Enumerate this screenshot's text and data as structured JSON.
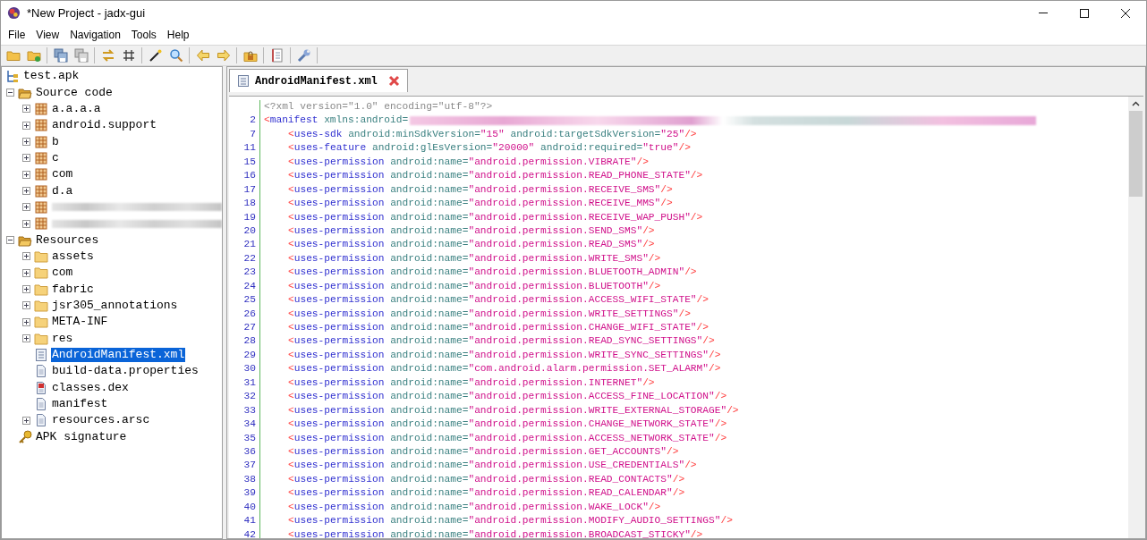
{
  "window": {
    "title": "*New Project - jadx-gui"
  },
  "menu": [
    "File",
    "View",
    "Navigation",
    "Tools",
    "Help"
  ],
  "tree": [
    {
      "label": "test.apk",
      "kind": "apk",
      "selected": false,
      "children": [
        {
          "label": "Source code",
          "kind": "source",
          "expanded": true,
          "selected": false,
          "children": [
            {
              "label": "a.a.a.a",
              "kind": "package",
              "expanded": false,
              "selected": false
            },
            {
              "label": "android.support",
              "kind": "package",
              "expanded": false,
              "selected": false
            },
            {
              "label": "b",
              "kind": "package",
              "expanded": false,
              "selected": false
            },
            {
              "label": "c",
              "kind": "package",
              "expanded": false,
              "selected": false
            },
            {
              "label": "com",
              "kind": "package",
              "expanded": false,
              "selected": false
            },
            {
              "label": "d.a",
              "kind": "package",
              "expanded": false,
              "selected": false
            },
            {
              "kind": "package",
              "redacted": true,
              "expanded": false,
              "selected": false
            },
            {
              "kind": "package",
              "redacted": true,
              "expanded": false,
              "selected": false
            }
          ]
        },
        {
          "label": "Resources",
          "kind": "resources",
          "expanded": true,
          "selected": false,
          "children": [
            {
              "label": "assets",
              "kind": "folder",
              "expanded": false,
              "selected": false
            },
            {
              "label": "com",
              "kind": "folder",
              "expanded": false,
              "selected": false
            },
            {
              "label": "fabric",
              "kind": "folder",
              "expanded": false,
              "selected": false
            },
            {
              "label": "jsr305_annotations",
              "kind": "folder",
              "expanded": false,
              "selected": false
            },
            {
              "label": "META-INF",
              "kind": "folder",
              "expanded": false,
              "selected": false
            },
            {
              "label": "res",
              "kind": "folder",
              "expanded": false,
              "selected": false
            },
            {
              "label": "AndroidManifest.xml",
              "kind": "xml",
              "selected": true
            },
            {
              "label": "build-data.properties",
              "kind": "file",
              "selected": false
            },
            {
              "label": "classes.dex",
              "kind": "dex",
              "selected": false
            },
            {
              "label": "manifest",
              "kind": "file",
              "selected": false
            },
            {
              "label": "resources.arsc",
              "kind": "file",
              "expanded": false,
              "selected": false
            }
          ]
        },
        {
          "label": "APK signature",
          "kind": "key",
          "selected": false
        }
      ]
    }
  ],
  "tabs": [
    {
      "label": "AndroidManifest.xml",
      "selected": true
    }
  ],
  "code": [
    {
      "segments": [
        {
          "kind": "decl",
          "text": "<?xml version=\"1.0\" encoding=\"utf-8\"?>"
        }
      ]
    },
    {
      "number": "2",
      "segments": [
        {
          "kind": "bracket",
          "text": "<"
        },
        {
          "kind": "tag",
          "text": "manifest"
        },
        {
          "kind": "attr",
          "text": " xmlns:android="
        },
        {
          "kind": "redacted"
        }
      ],
      "children": [
        {
          "number": "7",
          "segments": [
            {
              "kind": "bracket",
              "text": "<"
            },
            {
              "kind": "tag",
              "text": "uses-sdk"
            },
            {
              "kind": "attr",
              "text": " android:minSdkVersion="
            },
            {
              "kind": "value",
              "text": "\"15\""
            },
            {
              "kind": "attr",
              "text": " android:targetSdkVersion="
            },
            {
              "kind": "value",
              "text": "\"25\""
            },
            {
              "kind": "bracket",
              "text": "/>"
            }
          ]
        },
        {
          "number": "11",
          "segments": [
            {
              "kind": "bracket",
              "text": "<"
            },
            {
              "kind": "tag",
              "text": "uses-feature"
            },
            {
              "kind": "attr",
              "text": " android:glEsVersion="
            },
            {
              "kind": "value",
              "text": "\"20000\""
            },
            {
              "kind": "attr",
              "text": " android:required="
            },
            {
              "kind": "value",
              "text": "\"true\""
            },
            {
              "kind": "bracket",
              "text": "/>"
            }
          ]
        },
        {
          "number": "15",
          "segments": [
            {
              "kind": "bracket",
              "text": "<"
            },
            {
              "kind": "tag",
              "text": "uses-permission"
            },
            {
              "kind": "attr",
              "text": " android:name="
            },
            {
              "kind": "value",
              "text": "\"android.permission.VIBRATE\""
            },
            {
              "kind": "bracket",
              "text": "/>"
            }
          ]
        },
        {
          "number": "16",
          "segments": [
            {
              "kind": "bracket",
              "text": "<"
            },
            {
              "kind": "tag",
              "text": "uses-permission"
            },
            {
              "kind": "attr",
              "text": " android:name="
            },
            {
              "kind": "value",
              "text": "\"android.permission.READ_PHONE_STATE\""
            },
            {
              "kind": "bracket",
              "text": "/>"
            }
          ]
        },
        {
          "number": "17",
          "segments": [
            {
              "kind": "bracket",
              "text": "<"
            },
            {
              "kind": "tag",
              "text": "uses-permission"
            },
            {
              "kind": "attr",
              "text": " android:name="
            },
            {
              "kind": "value",
              "text": "\"android.permission.RECEIVE_SMS\""
            },
            {
              "kind": "bracket",
              "text": "/>"
            }
          ]
        },
        {
          "number": "18",
          "segments": [
            {
              "kind": "bracket",
              "text": "<"
            },
            {
              "kind": "tag",
              "text": "uses-permission"
            },
            {
              "kind": "attr",
              "text": " android:name="
            },
            {
              "kind": "value",
              "text": "\"android.permission.RECEIVE_MMS\""
            },
            {
              "kind": "bracket",
              "text": "/>"
            }
          ]
        },
        {
          "number": "19",
          "segments": [
            {
              "kind": "bracket",
              "text": "<"
            },
            {
              "kind": "tag",
              "text": "uses-permission"
            },
            {
              "kind": "attr",
              "text": " android:name="
            },
            {
              "kind": "value",
              "text": "\"android.permission.RECEIVE_WAP_PUSH\""
            },
            {
              "kind": "bracket",
              "text": "/>"
            }
          ]
        },
        {
          "number": "20",
          "segments": [
            {
              "kind": "bracket",
              "text": "<"
            },
            {
              "kind": "tag",
              "text": "uses-permission"
            },
            {
              "kind": "attr",
              "text": " android:name="
            },
            {
              "kind": "value",
              "text": "\"android.permission.SEND_SMS\""
            },
            {
              "kind": "bracket",
              "text": "/>"
            }
          ]
        },
        {
          "number": "21",
          "segments": [
            {
              "kind": "bracket",
              "text": "<"
            },
            {
              "kind": "tag",
              "text": "uses-permission"
            },
            {
              "kind": "attr",
              "text": " android:name="
            },
            {
              "kind": "value",
              "text": "\"android.permission.READ_SMS\""
            },
            {
              "kind": "bracket",
              "text": "/>"
            }
          ]
        },
        {
          "number": "22",
          "segments": [
            {
              "kind": "bracket",
              "text": "<"
            },
            {
              "kind": "tag",
              "text": "uses-permission"
            },
            {
              "kind": "attr",
              "text": " android:name="
            },
            {
              "kind": "value",
              "text": "\"android.permission.WRITE_SMS\""
            },
            {
              "kind": "bracket",
              "text": "/>"
            }
          ]
        },
        {
          "number": "23",
          "segments": [
            {
              "kind": "bracket",
              "text": "<"
            },
            {
              "kind": "tag",
              "text": "uses-permission"
            },
            {
              "kind": "attr",
              "text": " android:name="
            },
            {
              "kind": "value",
              "text": "\"android.permission.BLUETOOTH_ADMIN\""
            },
            {
              "kind": "bracket",
              "text": "/>"
            }
          ]
        },
        {
          "number": "24",
          "segments": [
            {
              "kind": "bracket",
              "text": "<"
            },
            {
              "kind": "tag",
              "text": "uses-permission"
            },
            {
              "kind": "attr",
              "text": " android:name="
            },
            {
              "kind": "value",
              "text": "\"android.permission.BLUETOOTH\""
            },
            {
              "kind": "bracket",
              "text": "/>"
            }
          ]
        },
        {
          "number": "25",
          "segments": [
            {
              "kind": "bracket",
              "text": "<"
            },
            {
              "kind": "tag",
              "text": "uses-permission"
            },
            {
              "kind": "attr",
              "text": " android:name="
            },
            {
              "kind": "value",
              "text": "\"android.permission.ACCESS_WIFI_STATE\""
            },
            {
              "kind": "bracket",
              "text": "/>"
            }
          ]
        },
        {
          "number": "26",
          "segments": [
            {
              "kind": "bracket",
              "text": "<"
            },
            {
              "kind": "tag",
              "text": "uses-permission"
            },
            {
              "kind": "attr",
              "text": " android:name="
            },
            {
              "kind": "value",
              "text": "\"android.permission.WRITE_SETTINGS\""
            },
            {
              "kind": "bracket",
              "text": "/>"
            }
          ]
        },
        {
          "number": "27",
          "segments": [
            {
              "kind": "bracket",
              "text": "<"
            },
            {
              "kind": "tag",
              "text": "uses-permission"
            },
            {
              "kind": "attr",
              "text": " android:name="
            },
            {
              "kind": "value",
              "text": "\"android.permission.CHANGE_WIFI_STATE\""
            },
            {
              "kind": "bracket",
              "text": "/>"
            }
          ]
        },
        {
          "number": "28",
          "segments": [
            {
              "kind": "bracket",
              "text": "<"
            },
            {
              "kind": "tag",
              "text": "uses-permission"
            },
            {
              "kind": "attr",
              "text": " android:name="
            },
            {
              "kind": "value",
              "text": "\"android.permission.READ_SYNC_SETTINGS\""
            },
            {
              "kind": "bracket",
              "text": "/>"
            }
          ]
        },
        {
          "number": "29",
          "segments": [
            {
              "kind": "bracket",
              "text": "<"
            },
            {
              "kind": "tag",
              "text": "uses-permission"
            },
            {
              "kind": "attr",
              "text": " android:name="
            },
            {
              "kind": "value",
              "text": "\"android.permission.WRITE_SYNC_SETTINGS\""
            },
            {
              "kind": "bracket",
              "text": "/>"
            }
          ]
        },
        {
          "number": "30",
          "segments": [
            {
              "kind": "bracket",
              "text": "<"
            },
            {
              "kind": "tag",
              "text": "uses-permission"
            },
            {
              "kind": "attr",
              "text": " android:name="
            },
            {
              "kind": "value",
              "text": "\"com.android.alarm.permission.SET_ALARM\""
            },
            {
              "kind": "bracket",
              "text": "/>"
            }
          ]
        },
        {
          "number": "31",
          "segments": [
            {
              "kind": "bracket",
              "text": "<"
            },
            {
              "kind": "tag",
              "text": "uses-permission"
            },
            {
              "kind": "attr",
              "text": " android:name="
            },
            {
              "kind": "value",
              "text": "\"android.permission.INTERNET\""
            },
            {
              "kind": "bracket",
              "text": "/>"
            }
          ]
        },
        {
          "number": "32",
          "segments": [
            {
              "kind": "bracket",
              "text": "<"
            },
            {
              "kind": "tag",
              "text": "uses-permission"
            },
            {
              "kind": "attr",
              "text": " android:name="
            },
            {
              "kind": "value",
              "text": "\"android.permission.ACCESS_FINE_LOCATION\""
            },
            {
              "kind": "bracket",
              "text": "/>"
            }
          ]
        },
        {
          "number": "33",
          "segments": [
            {
              "kind": "bracket",
              "text": "<"
            },
            {
              "kind": "tag",
              "text": "uses-permission"
            },
            {
              "kind": "attr",
              "text": " android:name="
            },
            {
              "kind": "value",
              "text": "\"android.permission.WRITE_EXTERNAL_STORAGE\""
            },
            {
              "kind": "bracket",
              "text": "/>"
            }
          ]
        },
        {
          "number": "34",
          "segments": [
            {
              "kind": "bracket",
              "text": "<"
            },
            {
              "kind": "tag",
              "text": "uses-permission"
            },
            {
              "kind": "attr",
              "text": " android:name="
            },
            {
              "kind": "value",
              "text": "\"android.permission.CHANGE_NETWORK_STATE\""
            },
            {
              "kind": "bracket",
              "text": "/>"
            }
          ]
        },
        {
          "number": "35",
          "segments": [
            {
              "kind": "bracket",
              "text": "<"
            },
            {
              "kind": "tag",
              "text": "uses-permission"
            },
            {
              "kind": "attr",
              "text": " android:name="
            },
            {
              "kind": "value",
              "text": "\"android.permission.ACCESS_NETWORK_STATE\""
            },
            {
              "kind": "bracket",
              "text": "/>"
            }
          ]
        },
        {
          "number": "36",
          "segments": [
            {
              "kind": "bracket",
              "text": "<"
            },
            {
              "kind": "tag",
              "text": "uses-permission"
            },
            {
              "kind": "attr",
              "text": " android:name="
            },
            {
              "kind": "value",
              "text": "\"android.permission.GET_ACCOUNTS\""
            },
            {
              "kind": "bracket",
              "text": "/>"
            }
          ]
        },
        {
          "number": "37",
          "segments": [
            {
              "kind": "bracket",
              "text": "<"
            },
            {
              "kind": "tag",
              "text": "uses-permission"
            },
            {
              "kind": "attr",
              "text": " android:name="
            },
            {
              "kind": "value",
              "text": "\"android.permission.USE_CREDENTIALS\""
            },
            {
              "kind": "bracket",
              "text": "/>"
            }
          ]
        },
        {
          "number": "38",
          "segments": [
            {
              "kind": "bracket",
              "text": "<"
            },
            {
              "kind": "tag",
              "text": "uses-permission"
            },
            {
              "kind": "attr",
              "text": " android:name="
            },
            {
              "kind": "value",
              "text": "\"android.permission.READ_CONTACTS\""
            },
            {
              "kind": "bracket",
              "text": "/>"
            }
          ]
        },
        {
          "number": "39",
          "segments": [
            {
              "kind": "bracket",
              "text": "<"
            },
            {
              "kind": "tag",
              "text": "uses-permission"
            },
            {
              "kind": "attr",
              "text": " android:name="
            },
            {
              "kind": "value",
              "text": "\"android.permission.READ_CALENDAR\""
            },
            {
              "kind": "bracket",
              "text": "/>"
            }
          ]
        },
        {
          "number": "40",
          "segments": [
            {
              "kind": "bracket",
              "text": "<"
            },
            {
              "kind": "tag",
              "text": "uses-permission"
            },
            {
              "kind": "attr",
              "text": " android:name="
            },
            {
              "kind": "value",
              "text": "\"android.permission.WAKE_LOCK\""
            },
            {
              "kind": "bracket",
              "text": "/>"
            }
          ]
        },
        {
          "number": "41",
          "segments": [
            {
              "kind": "bracket",
              "text": "<"
            },
            {
              "kind": "tag",
              "text": "uses-permission"
            },
            {
              "kind": "attr",
              "text": " android:name="
            },
            {
              "kind": "value",
              "text": "\"android.permission.MODIFY_AUDIO_SETTINGS\""
            },
            {
              "kind": "bracket",
              "text": "/>"
            }
          ]
        },
        {
          "number": "42",
          "segments": [
            {
              "kind": "bracket",
              "text": "<"
            },
            {
              "kind": "tag",
              "text": "uses-permission"
            },
            {
              "kind": "attr",
              "text": " android:name="
            },
            {
              "kind": "value",
              "text": "\"android.permission.BROADCAST_STICKY\""
            },
            {
              "kind": "bracket",
              "text": "/>"
            }
          ]
        }
      ]
    }
  ]
}
